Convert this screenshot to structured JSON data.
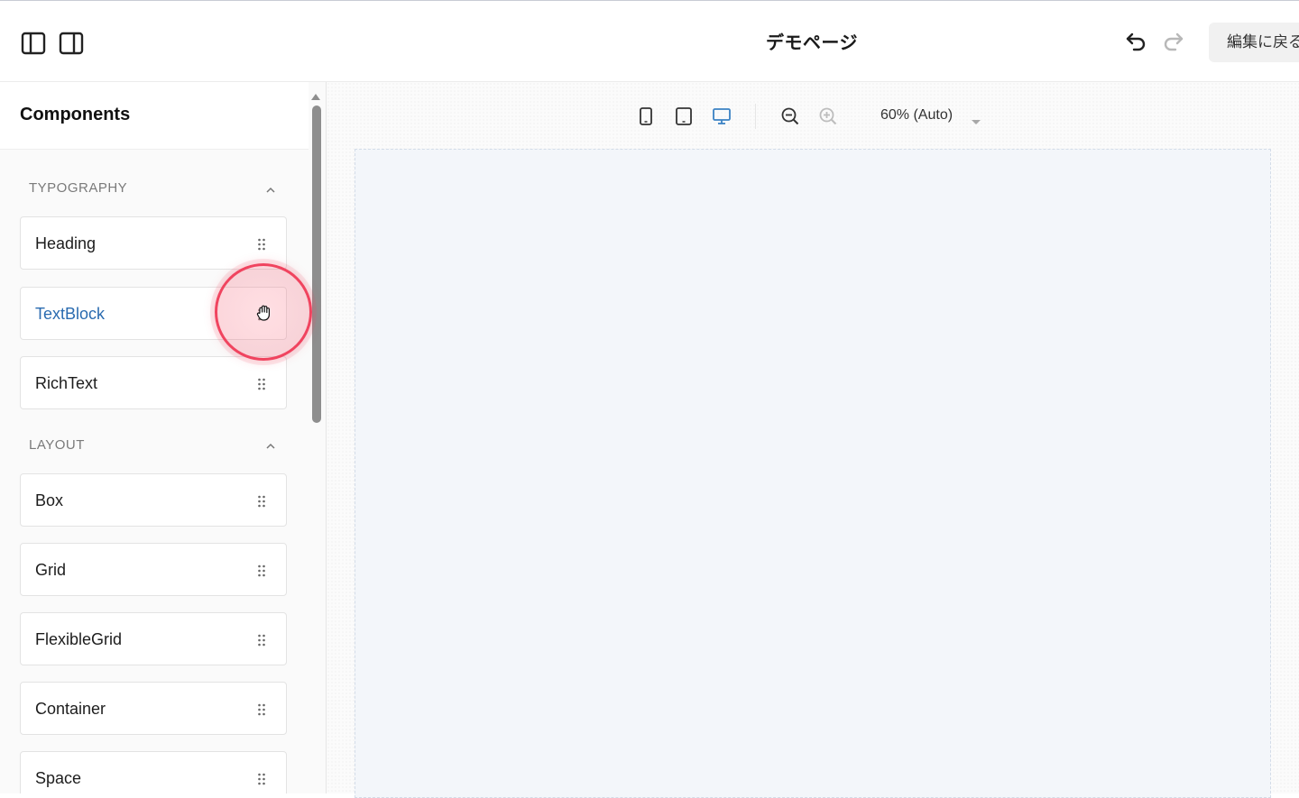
{
  "header": {
    "title": "デモページ",
    "back_label": "編集に戻る",
    "icons": {
      "left_panel": "sidebar-left-icon",
      "right_panel": "sidebar-right-icon",
      "undo": "undo-icon",
      "redo": "redo-icon"
    }
  },
  "sidebar": {
    "title": "Components",
    "sections": [
      {
        "label": "TYPOGRAPHY",
        "items": [
          {
            "label": "Heading"
          },
          {
            "label": "TextBlock"
          },
          {
            "label": "RichText"
          }
        ]
      },
      {
        "label": "LAYOUT",
        "items": [
          {
            "label": "Box"
          },
          {
            "label": "Grid"
          },
          {
            "label": "FlexibleGrid"
          },
          {
            "label": "Container"
          },
          {
            "label": "Space"
          }
        ]
      }
    ]
  },
  "canvas": {
    "toolbar": {
      "devices": [
        "mobile-icon",
        "tablet-icon",
        "desktop-icon"
      ],
      "active_device": "desktop-icon",
      "zoom_out": "zoom-out-icon",
      "zoom_in": "zoom-in-icon",
      "zoom_label": "60% (Auto)"
    }
  },
  "colors": {
    "accent": "#2a6bb0",
    "active_device": "#3b82c4",
    "cursor_ring": "#f0445f"
  }
}
